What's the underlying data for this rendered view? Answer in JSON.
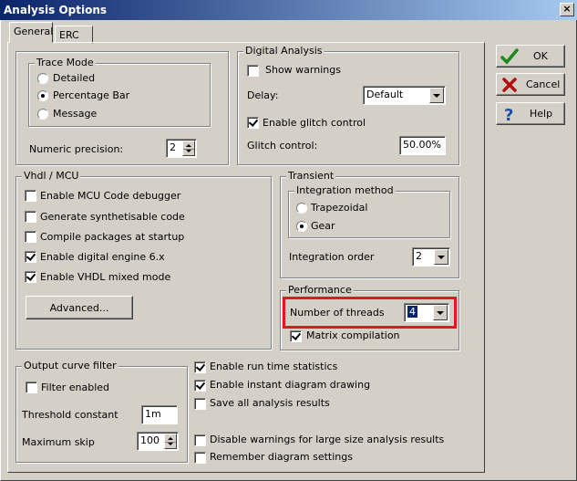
{
  "window": {
    "title": "Analysis Options",
    "close_glyph": "×"
  },
  "tabs": [
    {
      "label": "General"
    },
    {
      "label": "ERC"
    }
  ],
  "buttons": {
    "ok": "OK",
    "cancel": "Cancel",
    "help": "Help"
  },
  "trace_mode": {
    "title": "Trace Mode",
    "options": [
      {
        "label": "Detailed",
        "checked": false
      },
      {
        "label": "Percentage Bar",
        "checked": true
      },
      {
        "label": "Message",
        "checked": false
      }
    ],
    "numeric_precision_label": "Numeric precision:",
    "numeric_precision_value": "2"
  },
  "digital_analysis": {
    "title": "Digital Analysis",
    "show_warnings": "Show warnings",
    "delay_label": "Delay:",
    "delay_value": "Default",
    "enable_glitch": "Enable glitch control",
    "glitch_label": "Glitch control:",
    "glitch_value": "50.00%"
  },
  "vhdl": {
    "title": "Vhdl / MCU",
    "items": [
      {
        "label": "Enable MCU Code debugger",
        "checked": false
      },
      {
        "label": "Generate synthetisable code",
        "checked": false
      },
      {
        "label": "Compile packages at startup",
        "checked": false
      },
      {
        "label": "Enable digital engine 6.x",
        "checked": true
      },
      {
        "label": "Enable VHDL mixed mode",
        "checked": true
      }
    ],
    "advanced": "Advanced..."
  },
  "transient": {
    "title": "Transient",
    "integration_title": "Integration method",
    "methods": [
      {
        "label": "Trapezoidal",
        "checked": false
      },
      {
        "label": "Gear",
        "checked": true
      }
    ],
    "order_label": "Integration order",
    "order_value": "2"
  },
  "performance": {
    "title": "Performance",
    "threads_label": "Number of threads",
    "threads_value": "4",
    "matrix": "Matrix compilation"
  },
  "output_filter": {
    "title": "Output curve filter",
    "filter_enabled": "Filter enabled",
    "threshold_label": "Threshold constant",
    "threshold_value": "1m",
    "max_skip_label": "Maximum skip",
    "max_skip_value": "100"
  },
  "misc": [
    {
      "label": "Enable run time statistics",
      "checked": true
    },
    {
      "label": "Enable instant diagram drawing",
      "checked": true
    },
    {
      "label": "Save all analysis results",
      "checked": false
    },
    {
      "label": "Disable warnings for large size analysis results",
      "checked": false
    },
    {
      "label": "Remember diagram settings",
      "checked": false
    }
  ],
  "colors": {
    "highlight": "#e8151b",
    "title_start": "#0a246a"
  }
}
